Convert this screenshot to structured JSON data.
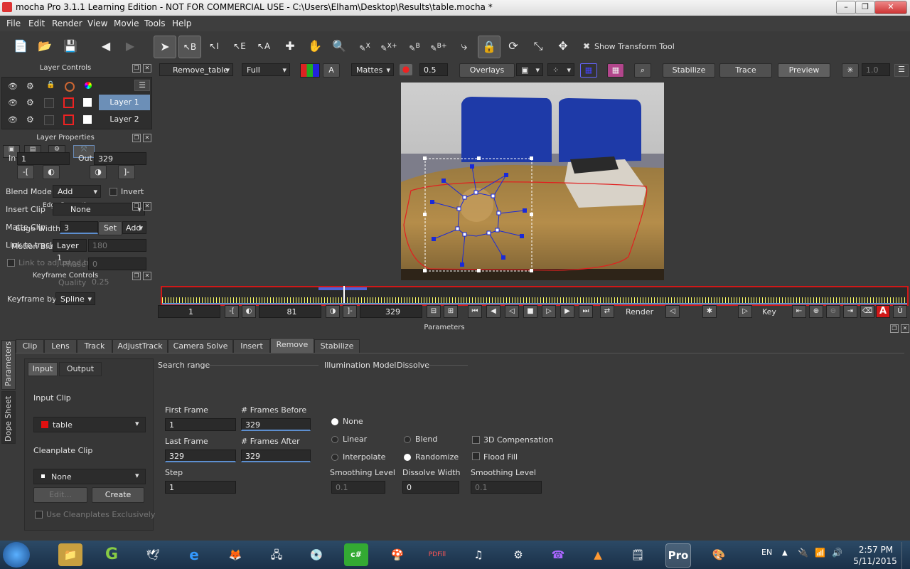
{
  "window": {
    "title": "mocha Pro 3.1.1 Learning Edition - NOT FOR COMMERCIAL USE - C:\\Users\\Elham\\Desktop\\Results\\table.mocha *",
    "min": "–",
    "max": "❐",
    "close": "✕"
  },
  "menu": [
    "File",
    "Edit",
    "Render",
    "View",
    "Movie",
    "Tools",
    "Help"
  ],
  "toolbar": {
    "b_label": "B",
    "i_label": "I",
    "e_label": "E",
    "a_label": "A",
    "x_label": "X",
    "xplus_label": "X+",
    "bb_label": "B",
    "bplus_label": "B+",
    "show_transform_tool": "Show Transform Tool"
  },
  "viewer_bar": {
    "layer_select": "Remove_table",
    "resolution": "Full",
    "a_label": "A",
    "mattes": "Mattes",
    "opacity": "0.5",
    "overlays": "Overlays",
    "stabilize": "Stabilize",
    "trace": "Trace",
    "preview": "Preview",
    "zoom_value": "1.0"
  },
  "layer_controls": {
    "title": "Layer Controls",
    "layers": [
      {
        "name": "Layer 1",
        "selected": true
      },
      {
        "name": "Layer 2",
        "selected": false
      }
    ]
  },
  "layer_properties": {
    "title": "Layer Properties",
    "in_label": "In",
    "in_value": "1",
    "out_label": "Out",
    "out_value": "329",
    "blend_mode_label": "Blend Mode",
    "blend_mode": "Add",
    "invert_label": "Invert",
    "insert_clip_label": "Insert Clip",
    "insert_clip": "None",
    "matte_clip_label": "Matte Clip",
    "link_to_track_label": "Link to track",
    "link_to_track": "Layer 1",
    "link_adjusted_label": "Link to adjusted tra..."
  },
  "edge_properties": {
    "title": "Edge Properties",
    "edge_width_label": "Edge Width",
    "edge_width": "3",
    "set_label": "Set",
    "add_label": "Add",
    "motion_blur_label": "Motion Blur",
    "angle": "180",
    "phase_label": "Phase",
    "phase": "0",
    "quality_label": "Quality",
    "quality": "0.25"
  },
  "keyframe_controls": {
    "title": "Keyframe Controls",
    "keyframe_by_label": "Keyframe by",
    "keyframe_by": "Spline"
  },
  "timeline": {
    "start": "1",
    "current": "81",
    "end": "329",
    "render_label": "Render",
    "key_label": "Key"
  },
  "parameters": {
    "title": "Parameters",
    "side_tabs": [
      "Parameters",
      "Dope Sheet"
    ],
    "tabs": [
      "Clip",
      "Lens",
      "Track",
      "AdjustTrack",
      "Camera Solve",
      "Insert",
      "Remove",
      "Stabilize"
    ],
    "active_tab": "Remove",
    "sub_tabs": [
      "Input",
      "Output"
    ],
    "input_clip_label": "Input Clip",
    "input_clip": "table",
    "cleanplate_clip_label": "Cleanplate Clip",
    "cleanplate_clip": "None",
    "edit_label": "Edit...",
    "create_label": "Create",
    "use_cleanplates_label": "Use Cleanplates Exclusively",
    "search_range_label": "Search range",
    "first_frame_label": "First Frame",
    "first_frame": "1",
    "frames_before_label": "# Frames Before",
    "frames_before": "329",
    "last_frame_label": "Last Frame",
    "last_frame": "329",
    "frames_after_label": "# Frames After",
    "frames_after": "329",
    "step_label": "Step",
    "step": "1",
    "illumination_label": "Illumination Model",
    "dissolve_label": "Dissolve",
    "none_label": "None",
    "linear_label": "Linear",
    "interpolate_label": "Interpolate",
    "blend_label": "Blend",
    "randomize_label": "Randomize",
    "compensation_label": "3D Compensation",
    "flood_fill_label": "Flood Fill",
    "smoothing_level_label": "Smoothing Level",
    "smoothing_level": "0.1",
    "dissolve_width_label": "Dissolve Width",
    "dissolve_width": "0",
    "smoothing_level2_label": "Smoothing Level",
    "smoothing_level2": "0.1"
  },
  "taskbar": {
    "lang": "EN",
    "time": "2:57 PM",
    "date": "5/11/2015",
    "pro_label": "Pro",
    "pdf_label": "PDFill",
    "csharp_label": "c#"
  }
}
